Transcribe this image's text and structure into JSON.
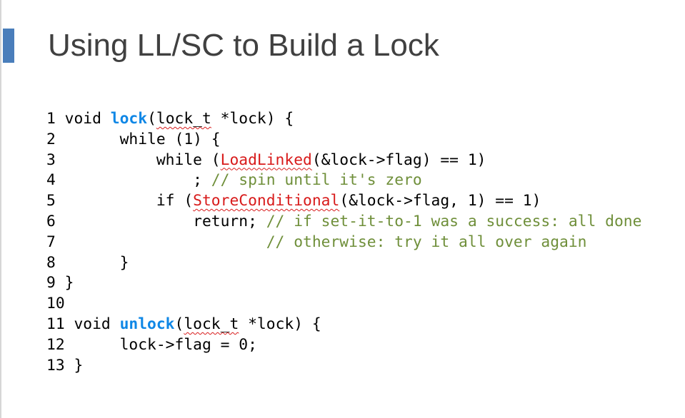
{
  "slide": {
    "title": "Using LL/SC to Build a Lock",
    "accent_color": "#4a7ebb",
    "code_lines": [
      [
        {
          "text": "1 void ",
          "style": "plain"
        },
        {
          "text": "lock",
          "style": "keyword"
        },
        {
          "text": "(",
          "style": "plain"
        },
        {
          "text": "lock_t",
          "style": "squiggle"
        },
        {
          "text": " *lock) {",
          "style": "plain"
        }
      ],
      [
        {
          "text": "2       while (1) {",
          "style": "plain"
        }
      ],
      [
        {
          "text": "3           while (",
          "style": "plain"
        },
        {
          "text": "LoadLinked",
          "style": "error"
        },
        {
          "text": "(&lock->flag) == 1)",
          "style": "plain"
        }
      ],
      [
        {
          "text": "4               ; ",
          "style": "plain"
        },
        {
          "text": "// spin until it's zero",
          "style": "comment"
        }
      ],
      [
        {
          "text": "5           if (",
          "style": "plain"
        },
        {
          "text": "StoreConditional",
          "style": "error"
        },
        {
          "text": "(&lock->flag, 1) == 1)",
          "style": "plain"
        }
      ],
      [
        {
          "text": "6               return; ",
          "style": "plain"
        },
        {
          "text": "// if set-it-to-1 was a success: all done",
          "style": "comment"
        }
      ],
      [
        {
          "text": "7                       ",
          "style": "plain"
        },
        {
          "text": "// otherwise: try it all over again",
          "style": "comment"
        }
      ],
      [
        {
          "text": "8       }",
          "style": "plain"
        }
      ],
      [
        {
          "text": "9 }",
          "style": "plain"
        }
      ],
      [
        {
          "text": "10",
          "style": "plain"
        }
      ],
      [
        {
          "text": "11 void ",
          "style": "plain"
        },
        {
          "text": "unlock",
          "style": "keyword"
        },
        {
          "text": "(",
          "style": "plain"
        },
        {
          "text": "lock_t",
          "style": "squiggle"
        },
        {
          "text": " *lock) {",
          "style": "plain"
        }
      ],
      [
        {
          "text": "12      lock->flag = 0;",
          "style": "plain"
        }
      ],
      [
        {
          "text": "13 }",
          "style": "plain"
        }
      ]
    ]
  }
}
